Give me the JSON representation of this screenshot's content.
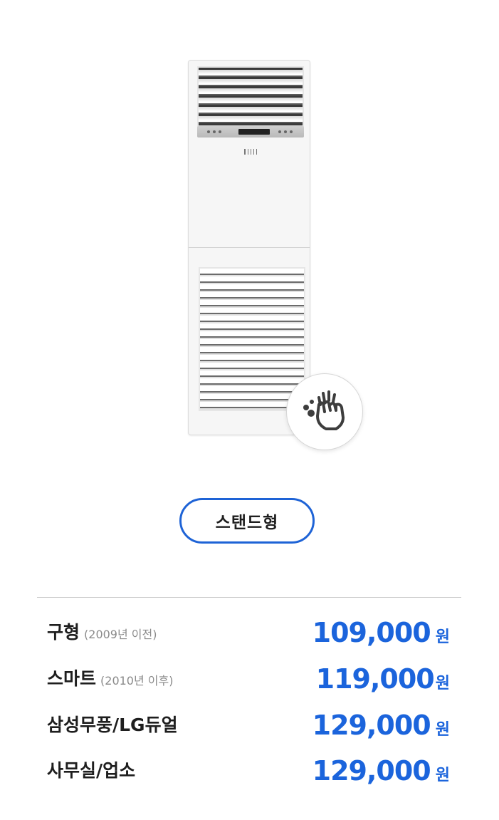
{
  "product": {
    "image_alt": "stand-type air conditioner",
    "badge_icon": "hand-cleaning-icon"
  },
  "category_button": {
    "label": "스탠드형"
  },
  "prices": [
    {
      "name": "구형",
      "note": "(2009년 이전)",
      "amount": "109,000",
      "unit": "원"
    },
    {
      "name": "스마트",
      "note": "(2010년 이후)",
      "amount": "119,000",
      "unit": "원"
    },
    {
      "name": "삼성무풍/LG듀얼",
      "note": "",
      "amount": "129,000",
      "unit": "원"
    },
    {
      "name": "사무실/업소",
      "note": "",
      "amount": "129,000",
      "unit": "원"
    }
  ],
  "colors": {
    "accent": "#1b64dc",
    "pill_border": "#1e63d6",
    "text": "#1e1e1e",
    "subtext": "#8a8a8a"
  }
}
